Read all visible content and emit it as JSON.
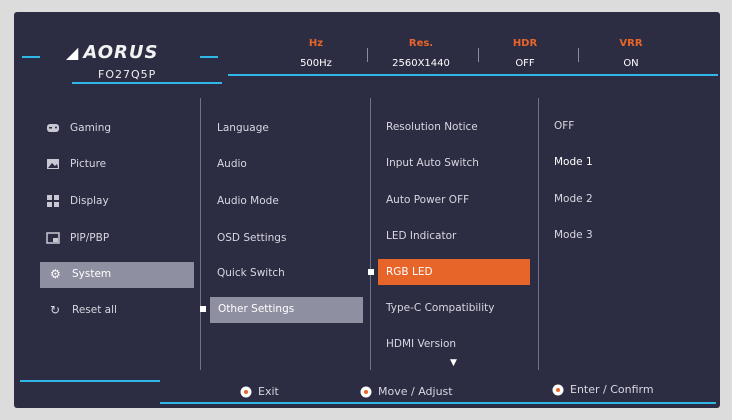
{
  "header": {
    "brand": "AORUS",
    "model": "FO27Q5P",
    "stats": [
      {
        "label": "Hz",
        "value": "500Hz"
      },
      {
        "label": "Res.",
        "value": "2560X1440"
      },
      {
        "label": "HDR",
        "value": "OFF"
      },
      {
        "label": "VRR",
        "value": "ON"
      }
    ]
  },
  "menu": {
    "main": [
      {
        "label": "Gaming",
        "icon": "gamepad-icon"
      },
      {
        "label": "Picture",
        "icon": "picture-icon"
      },
      {
        "label": "Display",
        "icon": "display-grid-icon"
      },
      {
        "label": "PIP/PBP",
        "icon": "pip-icon"
      },
      {
        "label": "System",
        "icon": "gear-icon",
        "selected": true
      },
      {
        "label": "Reset all",
        "icon": "reset-icon"
      }
    ],
    "system": [
      {
        "label": "Language"
      },
      {
        "label": "Audio"
      },
      {
        "label": "Audio Mode"
      },
      {
        "label": "OSD Settings"
      },
      {
        "label": "Quick Switch"
      },
      {
        "label": "Other Settings",
        "selected": true
      }
    ],
    "other_settings": [
      {
        "label": "Resolution Notice"
      },
      {
        "label": "Input Auto Switch"
      },
      {
        "label": "Auto Power OFF"
      },
      {
        "label": "LED Indicator"
      },
      {
        "label": "RGB LED",
        "selected": true
      },
      {
        "label": "Type-C Compatibility"
      },
      {
        "label": "HDMI Version"
      }
    ],
    "rgb_led_options": [
      {
        "label": "OFF"
      },
      {
        "label": "Mode 1",
        "current": true
      },
      {
        "label": "Mode 2"
      },
      {
        "label": "Mode 3"
      }
    ]
  },
  "footer": {
    "exit": "Exit",
    "move": "Move / Adjust",
    "enter": "Enter / Confirm"
  },
  "colors": {
    "accent": "#e8652a",
    "highlight_line": "#2fb7e8",
    "background": "#2c2c42",
    "selection": "#8f8fa2"
  }
}
